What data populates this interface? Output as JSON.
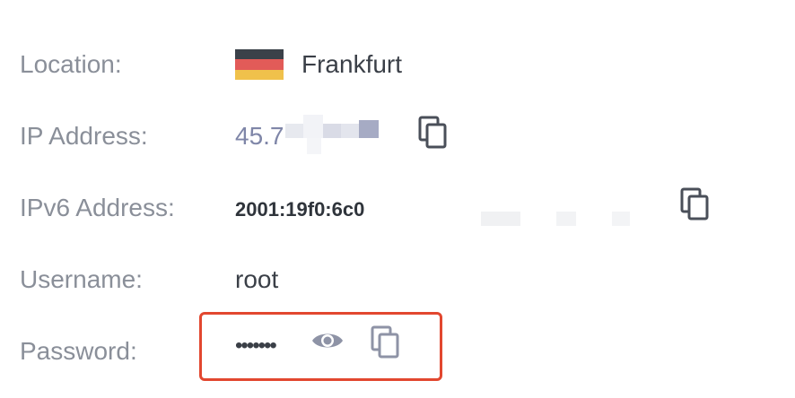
{
  "location": {
    "label": "Location:",
    "value": "Frankfurt",
    "flag_colors": [
      "#3b4149",
      "#e25b58",
      "#f0c14b"
    ]
  },
  "ip": {
    "label": "IP Address:",
    "value_visible": "45.7",
    "icon": "copy-icon"
  },
  "ipv6": {
    "label": "IPv6 Address:",
    "value_visible": "2001:19f0:6c0",
    "icon": "copy-icon"
  },
  "username": {
    "label": "Username:",
    "value": "root"
  },
  "password": {
    "label": "Password:",
    "value_masked": "•••••••",
    "icons": [
      "eye-icon",
      "copy-icon"
    ]
  },
  "colors": {
    "label": "#8a8f99",
    "value": "#3a3f47",
    "ip_value": "#7f86a8",
    "icon": "#8e93a6",
    "icon_dark": "#4a4f59",
    "highlight": "#e2472f"
  }
}
